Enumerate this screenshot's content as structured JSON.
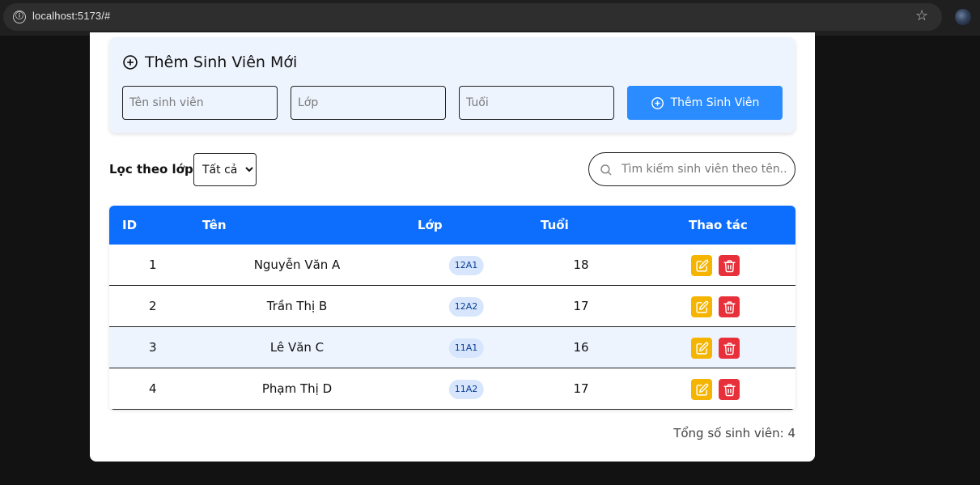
{
  "browser": {
    "url": "localhost:5173/#",
    "info_icon": "ⓘ",
    "star_icon": "☆"
  },
  "form": {
    "title": "Thêm Sinh Viên Mới",
    "name_placeholder": "Tên sinh viên",
    "class_placeholder": "Lớp",
    "age_placeholder": "Tuổi",
    "add_button_label": "Thêm Sinh Viên"
  },
  "filter": {
    "label": "Lọc theo lớp:",
    "options": [
      "Tất cả"
    ],
    "selected": "Tất cả"
  },
  "search": {
    "placeholder": "Tìm kiếm sinh viên theo tên..."
  },
  "table": {
    "headers": {
      "id": "ID",
      "name": "Tên",
      "class": "Lớp",
      "age": "Tuổi",
      "actions": "Thao tác"
    },
    "rows": [
      {
        "id": "1",
        "name": "Nguyễn Văn A",
        "class": "12A1",
        "age": "18"
      },
      {
        "id": "2",
        "name": "Trần Thị B",
        "class": "12A2",
        "age": "17"
      },
      {
        "id": "3",
        "name": "Lê Văn C",
        "class": "11A1",
        "age": "16"
      },
      {
        "id": "4",
        "name": "Phạm Thị D",
        "class": "11A2",
        "age": "17"
      }
    ]
  },
  "footer": {
    "total_text": "Tổng số sinh viên: 4"
  },
  "colors": {
    "primary": "#0d6efd",
    "add_button": "#2b8cff",
    "edit": "#f4b400",
    "delete": "#e8303a",
    "panel_bg": "#eef4fe"
  }
}
